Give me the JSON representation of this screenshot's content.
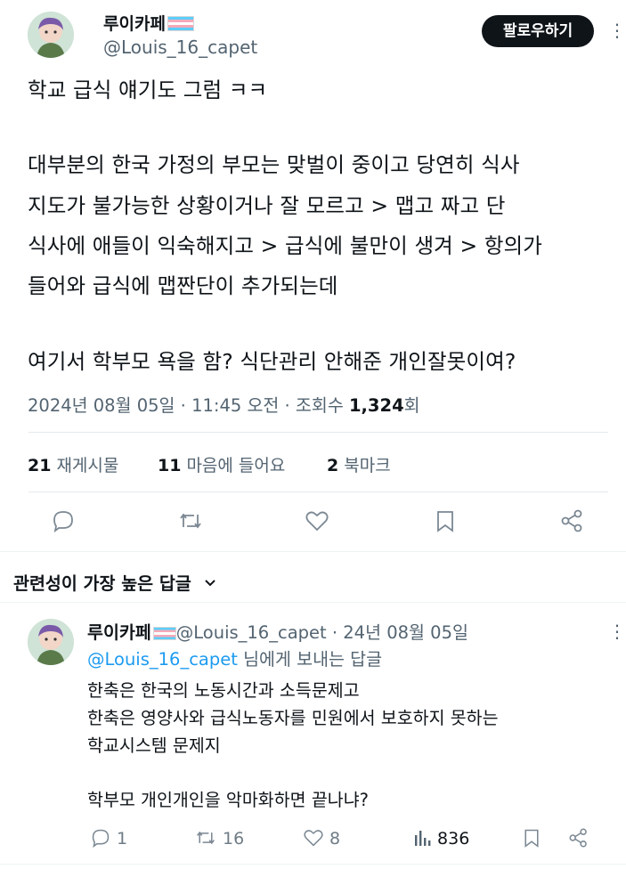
{
  "tweet": {
    "author_name": "루이카페",
    "author_handle": "@Louis_16_capet",
    "follow_label": "팔로우하기",
    "more_label": "⋮",
    "lines": [
      "학교 급식 얘기도 그럼 ㅋㅋ",
      "대부분의 한국 가정의 부모는 맞벌이 중이고 당연히 식사",
      "지도가 불가능한 상황이거나 잘 모르고 > 맵고 짜고 단",
      "식사에 애들이 익숙해지고 > 급식에 불만이 생겨 > 항의가",
      "들어와 급식에 맵짠단이 추가되는데",
      "여기서 학부모 욕을 함? 식단관리 안해준 개인잘못이여?"
    ],
    "meta_prefix": "2024년 08월 05일 · 11:45 오전 · 조회수 ",
    "views": "1,324",
    "views_suffix": "회",
    "stats": {
      "retweets_count": "21",
      "retweets_label": "재게시물",
      "likes_count": "11",
      "likes_label": "마음에 들어요",
      "bookmarks_count": "2",
      "bookmarks_label": "북마크"
    }
  },
  "replies_header": {
    "label": "관련성이 가장 높은 답글",
    "chevron": "⌄"
  },
  "reply": {
    "author_name": "루이카페",
    "handle_date": "@Louis_16_capet · 24년 08월 05일",
    "replying_mention": "@Louis_16_capet",
    "replying_suffix": " 님에게 보내는 답글",
    "more_label": "⋮",
    "lines": [
      "한축은 한국의 노동시간과 소득문제고",
      "한축은 영양사와 급식노동자를 민원에서 보호하지 못하는",
      "학교시스템 문제지",
      "학부모 개인개인을 악마화하면 끝나냐?"
    ],
    "actions": {
      "replies": "1",
      "retweets": "16",
      "likes": "8",
      "views": "836"
    }
  },
  "icons": {
    "reply": "speech-bubble-icon",
    "retweet": "retweet-arrows-icon",
    "like": "heart-icon",
    "bookmark": "bookmark-icon",
    "share": "share-icon",
    "views": "bar-chart-icon"
  },
  "colors": {
    "text": "#0f1419",
    "secondary": "#536471",
    "link": "#1d9bf0",
    "button": "#0f1419"
  }
}
